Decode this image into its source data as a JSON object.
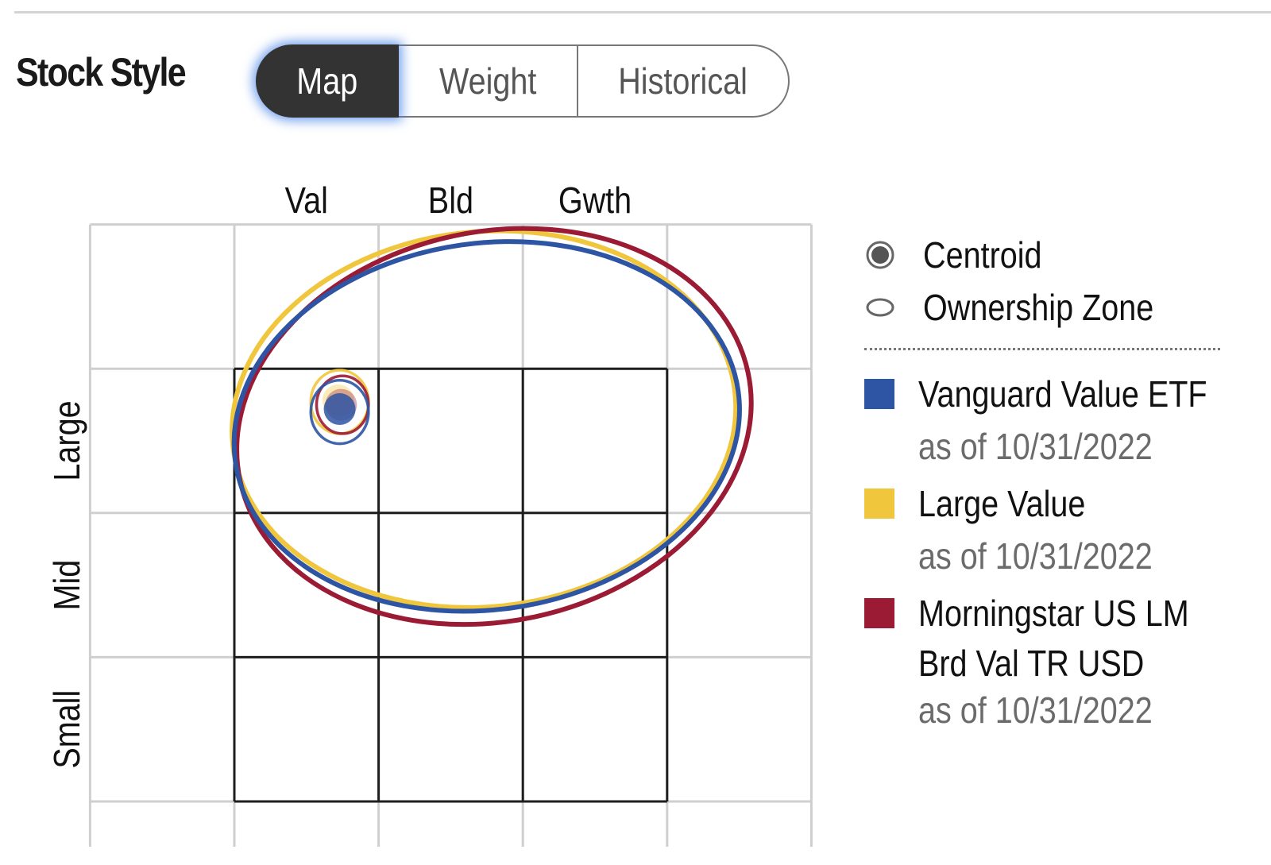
{
  "header": {
    "title": "Stock Style",
    "tabs": [
      {
        "label": "Map",
        "active": true
      },
      {
        "label": "Weight",
        "active": false
      },
      {
        "label": "Historical",
        "active": false
      }
    ]
  },
  "legend": {
    "symbols": [
      {
        "icon": "centroid-icon",
        "label": "Centroid"
      },
      {
        "icon": "ownership-zone-icon",
        "label": "Ownership Zone"
      }
    ],
    "series": [
      {
        "name_lines": [
          "Vanguard Value ETF"
        ],
        "date": "as of 10/31/2022",
        "color": "#2E55A3"
      },
      {
        "name_lines": [
          "Large Value"
        ],
        "date": "as of 10/31/2022",
        "color": "#F0C63C"
      },
      {
        "name_lines": [
          "Morningstar US LM",
          "Brd Val TR USD"
        ],
        "date": "as of 10/31/2022",
        "color": "#9B1B34"
      }
    ]
  },
  "chart_data": {
    "type": "scatter",
    "title": "Stock Style Map",
    "x_categories": [
      "Val",
      "Bld",
      "Gwth"
    ],
    "y_categories": [
      "Large",
      "Mid",
      "Small"
    ],
    "x_range": [
      -1,
      4
    ],
    "y_range": [
      -0.3,
      4
    ],
    "grid": true,
    "legend_position": "right",
    "note": "Style box spans x 0-3 (Val 0-1, Bld 1-2, Gwth 2-3) and y 0-3 (Small 0-1, Mid 1-2, Large 2-3)",
    "series": [
      {
        "name": "Vanguard Value ETF",
        "color": "#2E55A3",
        "centroid": {
          "x": 0.73,
          "y": 2.72
        },
        "centroid_zone": {
          "rx": 0.2,
          "ry": 0.22,
          "cx": 0.73,
          "cy": 2.7
        },
        "ownership_zone": {
          "cx": 1.75,
          "cy": 2.6,
          "rx": 1.76,
          "ry": 1.27,
          "rotation_deg": -8
        }
      },
      {
        "name": "Large Value",
        "color": "#F0C63C",
        "centroid": {
          "x": 0.72,
          "y": 2.78
        },
        "centroid_zone": {
          "rx": 0.2,
          "ry": 0.22,
          "cx": 0.73,
          "cy": 2.77
        },
        "ownership_zone": {
          "cx": 1.73,
          "cy": 2.65,
          "rx": 1.75,
          "ry": 1.3,
          "rotation_deg": -6
        }
      },
      {
        "name": "Morningstar US LM Brd Val TR USD",
        "color": "#9B1B34",
        "centroid": {
          "x": 0.74,
          "y": 2.75
        },
        "centroid_zone": {
          "rx": 0.18,
          "ry": 0.2,
          "cx": 0.75,
          "cy": 2.75
        },
        "ownership_zone": {
          "cx": 1.8,
          "cy": 2.6,
          "rx": 1.8,
          "ry": 1.35,
          "rotation_deg": -12
        }
      }
    ]
  }
}
